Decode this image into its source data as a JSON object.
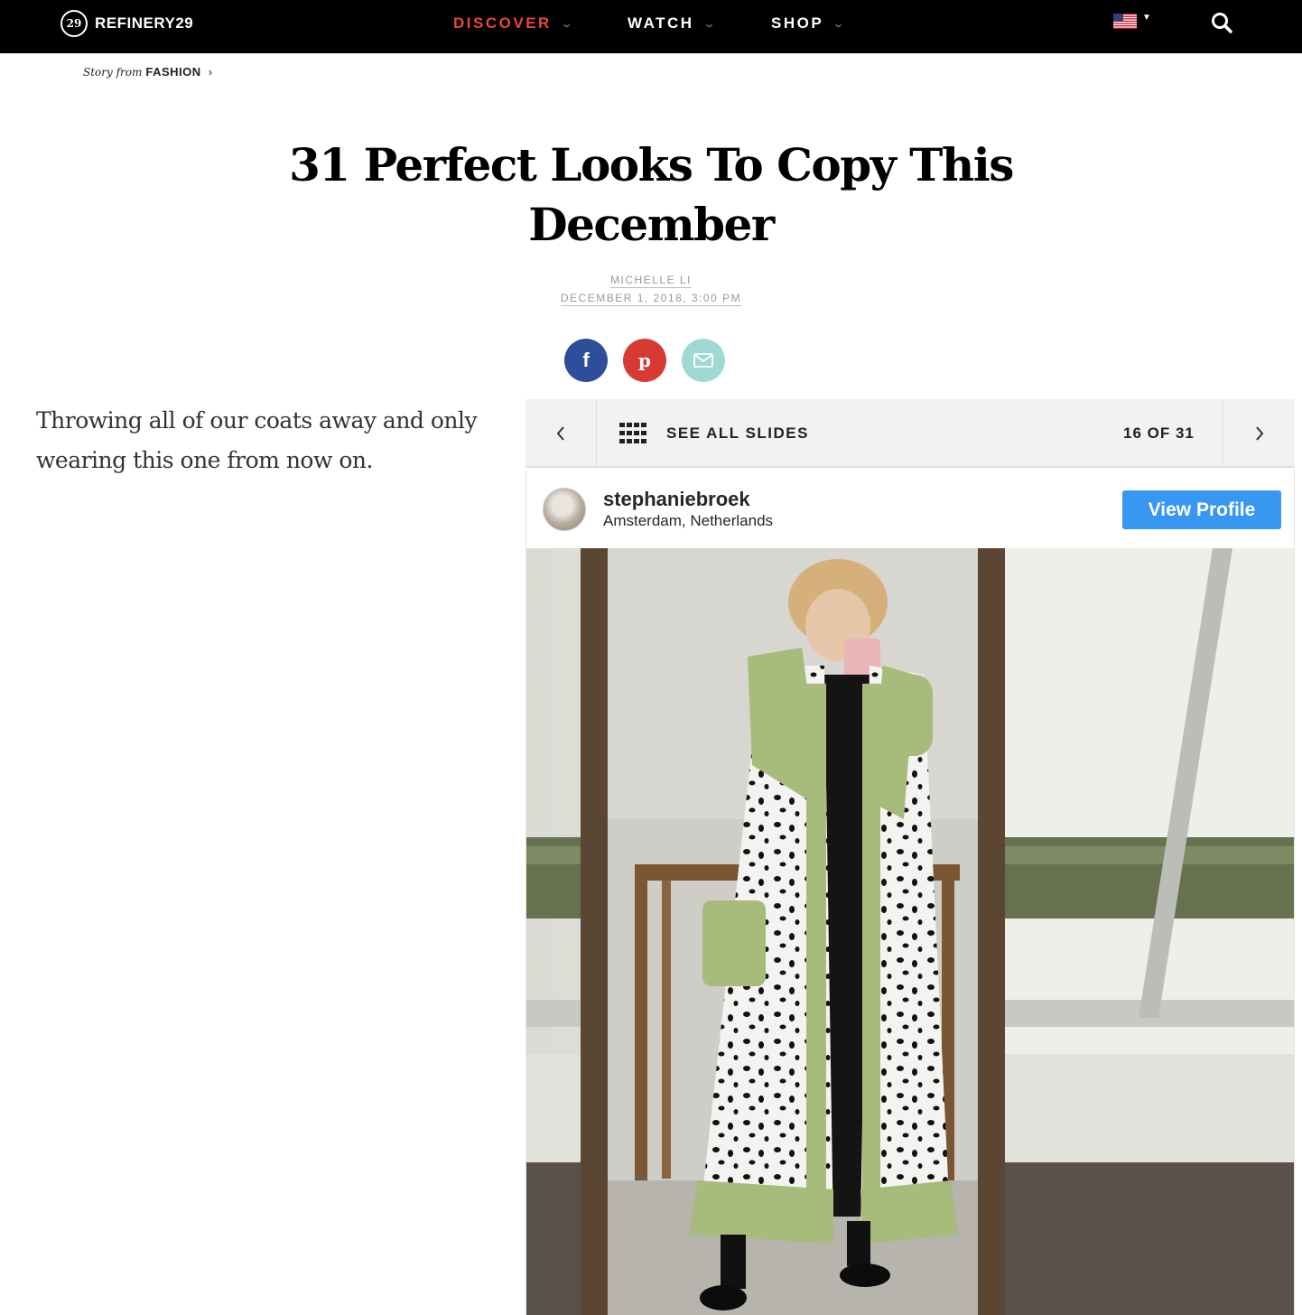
{
  "nav": {
    "brand": "REFINERY29",
    "brand_mark": "29",
    "links": [
      {
        "label": "DISCOVER",
        "active": true
      },
      {
        "label": "WATCH",
        "active": false
      },
      {
        "label": "SHOP",
        "active": false
      }
    ],
    "chevron": "⌄",
    "region_icon": "us-flag-icon",
    "search_icon": "search-icon"
  },
  "breadcrumb": {
    "prefix": "Story from",
    "section": "FASHION",
    "arrow": "›"
  },
  "article": {
    "title": "31 Perfect Looks To Copy This December",
    "author": "MICHELLE LI",
    "date": "DECEMBER 1, 2018, 3:00 PM",
    "body": "Throwing all of our coats away and only wearing this one from now on."
  },
  "share": {
    "facebook": "f",
    "pinterest": "p",
    "email_icon": "mail-icon"
  },
  "slideshow": {
    "see_all_label": "SEE ALL SLIDES",
    "counter": "16 OF 31",
    "prev_icon": "chevron-left-icon",
    "next_icon": "chevron-right-icon"
  },
  "instagram": {
    "username": "stephaniebroek",
    "location": "Amsterdam, Netherlands",
    "button_label": "View Profile"
  },
  "colors": {
    "accent": "#e8463d",
    "facebook": "#2e4d9b",
    "pinterest": "#d63a33",
    "email": "#9fd9d6",
    "instagram_button": "#3897f0"
  }
}
